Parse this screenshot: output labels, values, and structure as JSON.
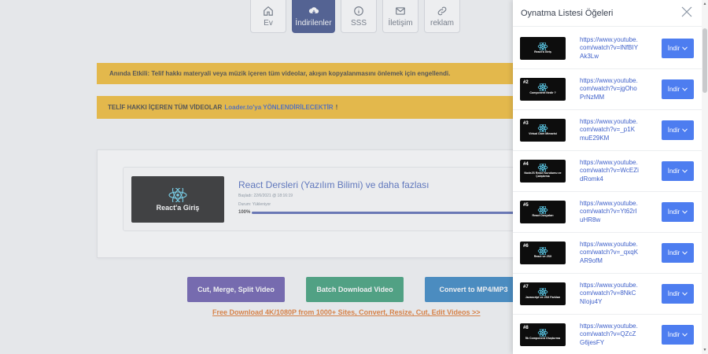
{
  "nav": [
    {
      "label": "Ev",
      "icon": "home-icon"
    },
    {
      "label": "İndirilenler",
      "icon": "download-cloud-icon",
      "active": true
    },
    {
      "label": "SSS",
      "icon": "info-icon"
    },
    {
      "label": "İletişim",
      "icon": "mail-icon"
    },
    {
      "label": "reklam",
      "icon": "link-icon"
    }
  ],
  "banners": {
    "notice": "Anında Etkili: Telif hakkı materyali veya müzik içeren tüm videolar, akışın kopyalanmasını önlemek için engellendi.",
    "redirect_prefix": "TELİF HAKKI İÇEREN TÜM VİDEOLAR",
    "redirect_link": "Loader.to'ya YÖNLENDİRİLECEKTİR",
    "redirect_suffix": "!"
  },
  "media": {
    "thumb_text": "React'a Giriş",
    "title": "React Dersleri (Yazılım Bilimi) ve daha fazlası",
    "date": "Başladı: 22/6/2021 @ 18:16:19",
    "status": "Durum: Yükleniyor",
    "progress_label": "100%",
    "progress": 1.0
  },
  "actions": {
    "cut": "Cut, Merge, Split Video",
    "batch": "Batch Download Video",
    "convert": "Convert to MP4/MP3",
    "promo": "Free Download 4K/1080P from 1000+ Sites, Convert, Resize, Cut, Edit Videos >>"
  },
  "panel": {
    "title": "Oynatma Listesi Öğeleri",
    "download_label": "İndir",
    "items": [
      {
        "num": "",
        "caption": "React'a Giriş",
        "url": "https://www.youtube.com/watch?v=lNfBIYAk3Lw"
      },
      {
        "num": "#2",
        "caption": "Component Nedir ?",
        "url": "https://www.youtube.com/watch?v=jgOhoPrNzMM"
      },
      {
        "num": "#3",
        "caption": "Virtual Dom Mimarisi",
        "url": "https://www.youtube.com/watch?v=_p1KmuE29KM"
      },
      {
        "num": "#4",
        "caption": "NodeJS React Kurulumu ve Çalıştırma",
        "url": "https://www.youtube.com/watch?v=WcEZidRomk4"
      },
      {
        "num": "#5",
        "caption": "React Dosyaları",
        "url": "https://www.youtube.com/watch?v=Yt62rIuHR8w"
      },
      {
        "num": "#6",
        "caption": "React ve JSX",
        "url": "https://www.youtube.com/watch?v=_qxqKAR9ofM"
      },
      {
        "num": "#7",
        "caption": "Javascript ve JSX Farkları",
        "url": "https://www.youtube.com/watch?v=8NkCNIoju4Y"
      },
      {
        "num": "#8",
        "caption": "İlk Component Oluşturma",
        "url": "https://www.youtube.com/watch?v=QZcZG6jesFY"
      }
    ]
  },
  "colors": {
    "accent": "#4d7df0",
    "banner": "#f1b51c",
    "nav_active": "#2c3f7f"
  }
}
